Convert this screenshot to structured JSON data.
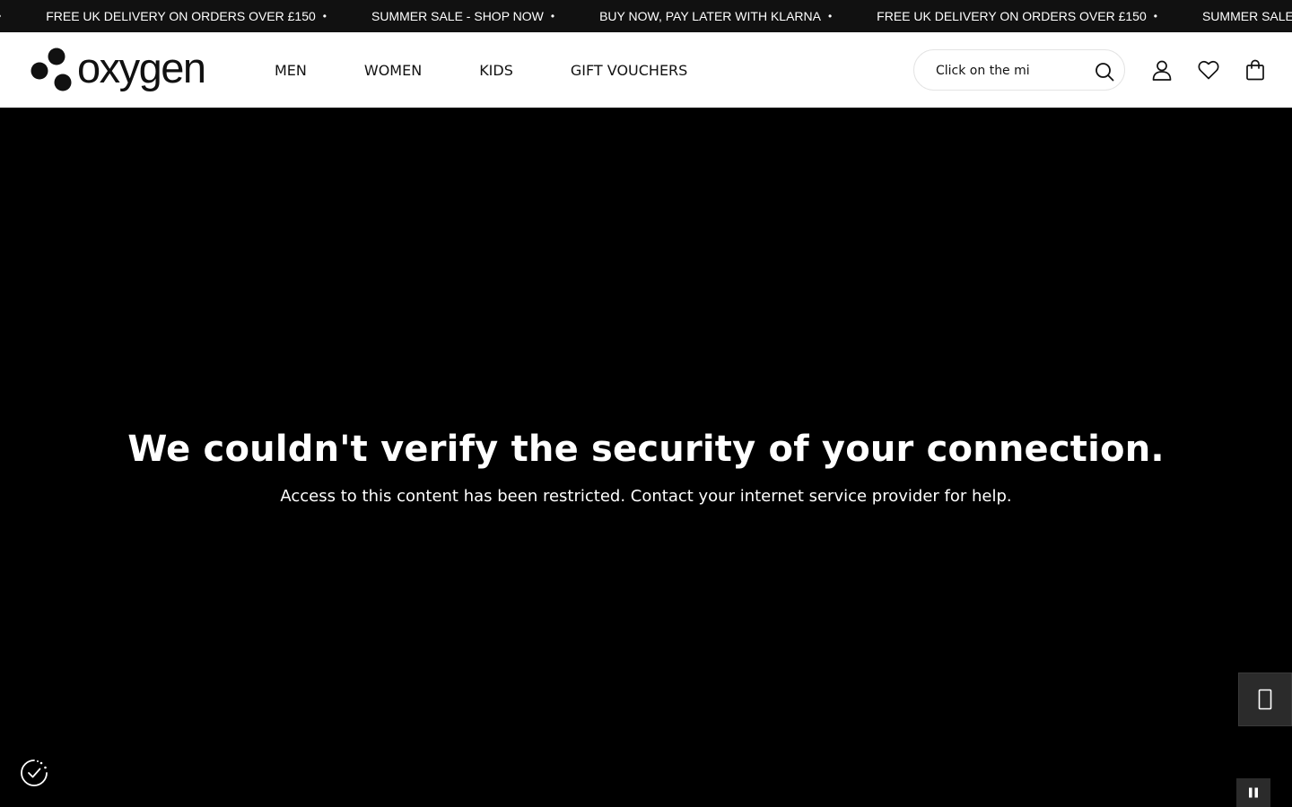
{
  "ticker": {
    "items": [
      "FREE UK DELIVERY ON ORDERS OVER £150",
      "SUMMER SALE - SHOP NOW",
      "BUY NOW, PAY LATER WITH KLARNA",
      "FREE UK DELIVERY ON ORDERS OVER £150",
      "SUMMER SALE - SHOP NOW"
    ],
    "separator": "•",
    "text_color": "#ffffff",
    "background": "#111111"
  },
  "header": {
    "logo_text": "oxygen",
    "nav": [
      "MEN",
      "WOMEN",
      "KIDS",
      "GIFT VOUCHERS"
    ],
    "search": {
      "value": "Click on the mi",
      "icon": "search-icon"
    },
    "icons": [
      "account-icon",
      "wishlist-heart-icon",
      "shopping-bag-icon"
    ]
  },
  "error": {
    "title": "We couldn't verify the security of your connection.",
    "message": "Access to this content has been restricted. Contact your internet service provider for help."
  },
  "widgets": {
    "side_icon": "phone-icon",
    "cookie_icon": "cookie-consent-icon",
    "pause_icon": "pause-icon"
  },
  "colors": {
    "page_background": "#000000",
    "header_background": "#ffffff",
    "text_primary": "#111111"
  }
}
